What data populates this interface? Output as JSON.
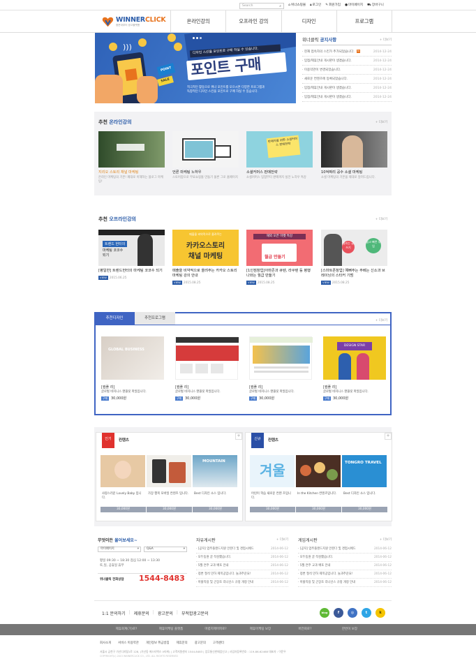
{
  "top": {
    "search_placeholder": "Search",
    "links": [
      "위너쇼핑몰",
      "로그인",
      "회원가입",
      "마이페이지",
      "장바구니"
    ]
  },
  "header": {
    "brand_a": "WINNER",
    "brand_b": "CLICK",
    "slogan": "중문대부터 광고플랫폼",
    "menu": [
      "온라인강의",
      "오프라인 강의",
      "디자인",
      "프로그램"
    ]
  },
  "banner": {
    "top_text": "디자인 스킨을 포인트로 구매 하실 수 있습니다.",
    "title": "포인트 구매",
    "desc1": "적극적인 활동으로 위너 포인트를 모으시면 다양한 프로그램과",
    "desc2": "독창적인 디자인 스킨을 포인트로 구매 하실 수 있습니다.",
    "badge": "POINT",
    "sale": "SALE"
  },
  "notice": {
    "title_a": "위너클릭 ",
    "title_b": "공지사항",
    "more": "+ 더보기",
    "items": [
      {
        "text": "현재 접속자의 스킨가 추가되었습니다.",
        "new": "N",
        "date": "2014-12-24"
      },
      {
        "text": "입접/제휴안내 게시판이 생겼습니다.",
        "new": "",
        "date": "2014-12-24"
      },
      {
        "text": "이용약관이 변경되었습니다.",
        "new": "",
        "date": "2014-12-24"
      },
      {
        "text": "새로운 컨텐츠에 등록되었습니다.",
        "new": "",
        "date": "2014-12-24"
      },
      {
        "text": "입점/제휴안내 게시판이 생겼습니다.",
        "new": "",
        "date": "2014-12-24"
      },
      {
        "text": "입점/제휴안내 게시판이 생겼습니다.",
        "new": "",
        "date": "2014-12-24"
      }
    ]
  },
  "online": {
    "title_a": "추천 ",
    "title_b": "온라인강의",
    "more": "+ 더보기",
    "cards": [
      {
        "title": "지리오 스토리 채널 마케팅",
        "desc": "온라인 마케팅의 기본! 제대로 이해하는 블로그 마케팅!"
      },
      {
        "title": "언론 마케팅 노하우",
        "desc": "스토어팜으로 무료쇼핑몰 만들기 물론 그로 홈페이지"
      },
      {
        "title": "소셜커머스 판매전략",
        "desc": "소셜커머스 입점부터 판매까지 실전 노하우 특강"
      },
      {
        "title": "10억짜리 공수 소셜 마케팅",
        "desc": "소셜 마케팅의 기본을 제대로 알려드립니다."
      }
    ],
    "card_tags": [
      "마케팅 실무",
      "NEW",
      "판매자를 위한 소셜커머스 판매전략",
      ""
    ]
  },
  "offline": {
    "title_a": "추천 ",
    "title_b": "오프라인강의",
    "more": "+ 더보기",
    "cards": [
      {
        "title": "[평일반] 트렌드헌터의 마케팅 코코수 되기",
        "date": "2015.06.25"
      },
      {
        "title": "매출을 비약적으로 올려주는 카카오 스토리 마케팅 강의 안내",
        "date": "2015.08.25"
      },
      {
        "title": "[1인점창업]아마존과 큐텐, 라쿠텐 등 평행 나와는 월급 만들기",
        "date": "2015.08.25"
      },
      {
        "title": "[스마트폰창업] 예뻐주는 주베는 신소과 브레이닝의 스타커 기범",
        "date": "2015.08.25"
      }
    ],
    "view_label": "VIEW",
    "thumb_texts": [
      "트렌드 헌터의",
      "카카오스토리",
      "해외 오픈 마켓 특강",
      "팔리는 글쓰기"
    ],
    "thumb_sub": [
      "마케팅 코코수 되기",
      "채널 마케팅",
      "월급 만들기",
      "쉽고 빠른 부업"
    ],
    "thumb_small": [
      "",
      "매출을 비약적으로 올려주는",
      "",
      ""
    ]
  },
  "design": {
    "tab_active": "추천디자인",
    "tab_other": "추천프로그램",
    "more": "+ 더보기",
    "items": [
      {
        "cat": "[컴플 리]",
        "desc": "글로벌 비지니스 맨플릿 파일입니다.",
        "btn": "구매",
        "price": "30,000원"
      },
      {
        "cat": "[컴플 리]",
        "desc": "글로벌 비지니스 맨플릿 파일입니다.",
        "btn": "구매",
        "price": "30,000원"
      },
      {
        "cat": "[컴플 리]",
        "desc": "글로벌 비지니스 맨플릿 파일입니다.",
        "btn": "구매",
        "price": "30,000원"
      },
      {
        "cat": "[컴플 리]",
        "desc": "글로벌 비지니스 맨플릿 파일입니다.",
        "btn": "구매",
        "price": "30,000원"
      }
    ],
    "thumb1": "GLOBAL BUSINESS",
    "thumb4": "DESIGN STAR"
  },
  "popular": {
    "badge": "인기",
    "title": "컨텐츠",
    "plus": "+",
    "items": [
      {
        "desc": "사랑스러운 Lovely Baby 입니다.",
        "price": "30,000원"
      },
      {
        "desc": "가장 행복 모바일 컨텐츠 입니다.",
        "price": "30,000원"
      },
      {
        "desc": "Best 디자인 소스 입니다.",
        "price": "30,000원"
      }
    ],
    "thumb3": "MOUNTAIN"
  },
  "newc": {
    "badge": "신규",
    "title": "컨텐츠",
    "plus": "+",
    "items": [
      {
        "desc": "어린이 학습 새로운 컨텐 츠입니다.",
        "price": "30,000원"
      },
      {
        "desc": "In the Kitchen 컨텐츠입니다.",
        "price": "30,000원"
      },
      {
        "desc": "Best 디자인 소스 입니다.",
        "price": "30,000원"
      }
    ],
    "thumb1": "겨울",
    "thumb3": "TONGRO TRAVEL"
  },
  "cs": {
    "title_a": "무엇이든 ",
    "title_b": "물어보세요~",
    "select1": "마이페이지",
    "select2": "Q&A",
    "hours1": "평일 09:30 ~ 18:30  점심 12:00 ~ 13:30",
    "hours2": "토,일, 공휴일 휴무",
    "phone_label": "위너클릭 전화상담",
    "phone": "1544-8483"
  },
  "free_board": {
    "title": "자유게시판",
    "more": "+ 더보기",
    "rows": [
      {
        "text": "[공지] 업주플랜드지원 안된다 및 경험시에드",
        "date": "2014-06-12"
      },
      {
        "text": "모두동원 글 작성했습니다.",
        "date": "2014-06-12"
      },
      {
        "text": "5월 연주 교과 배포 안내",
        "date": "2014-06-12"
      },
      {
        "text": "정변 절석 만하 제목공입니다. 놀과주운요!",
        "date": "2014-06-12"
      },
      {
        "text": "아울작용 및 곤장조 리니선스 규정 개정 안내",
        "date": "2014-06-12"
      }
    ]
  },
  "notice_board": {
    "title": "게임게시판",
    "more": "+ 더보기",
    "rows": [
      {
        "text": "[공지] 업주플랜드지원 안된다 및 경험시에드",
        "date": "2014-06-12"
      },
      {
        "text": "모두동원 글 작성했습니다.",
        "date": "2014-06-12"
      },
      {
        "text": "5월 연주 교과 배포 안내",
        "date": "2014-06-12"
      },
      {
        "text": "정변 절석 만하 제목공입니다. 놀과주운요!",
        "date": "2014-06-12"
      },
      {
        "text": "아울작용 및 곤장조 리니선스 규정 개정 안내",
        "date": "2014-06-12"
      }
    ]
  },
  "quicklinks": {
    "items": [
      "1:1 문의하기",
      "제휴문의",
      "광고문의",
      "부적합광고문의"
    ]
  },
  "social": {
    "items": [
      "blog",
      "f",
      "◎",
      "t",
      "k"
    ]
  },
  "footnav": {
    "items": [
      "제휴회계(가)로?",
      "제휴마케팅 플랫폼",
      "마렵지제머피로?",
      "제휴마케팅 보장",
      "버전회로?",
      "한번이 보장"
    ]
  },
  "footer": {
    "links": [
      "회사소개",
      "서비스 이용약관",
      "개인정보 취급방침",
      "제휴문의",
      "광고문의",
      "고객센터"
    ],
    "addr": "서울시 금천구 가산디지털1로 128, (가산동 에스티엑스 V타워) | 고객지원센터 1544-8483 | 업무통신판매업신고 | 사업자등록번호 : 119-86-62468 대표자 : 이문우",
    "copy": "COPYRIGHT(c) 2015 WINNERCLICK CO., LTD. ALL RIGHTS RESERVED"
  },
  "colors": {
    "brand_blue": "#2a5ba8",
    "accent_orange": "#e8731d",
    "tab_blue": "#3f64c3"
  }
}
